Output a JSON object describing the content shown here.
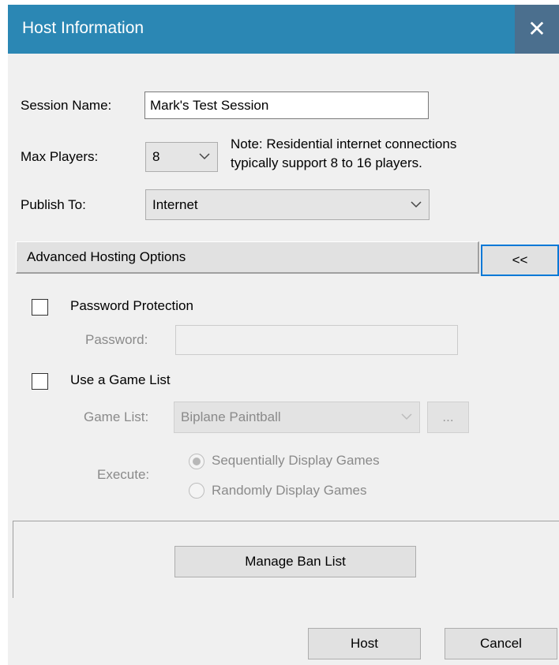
{
  "window": {
    "title": "Host Information",
    "close_symbol": "✕"
  },
  "session": {
    "label": "Session Name:",
    "value": "Mark's Test Session"
  },
  "max_players": {
    "label": "Max Players:",
    "value": "8",
    "note_line1": "Note: Residential internet connections",
    "note_line2": "typically support 8 to 16 players."
  },
  "publish": {
    "label": "Publish To:",
    "value": "Internet"
  },
  "advanced": {
    "label": "Advanced Hosting Options",
    "toggle_label": "<<"
  },
  "password": {
    "checkbox_label": "Password Protection",
    "field_label": "Password:",
    "value": "",
    "checked": false
  },
  "game_list": {
    "checkbox_label": "Use a Game List",
    "checked": false,
    "field_label": "Game List:",
    "value": "Biplane Paintball",
    "browse_label": "..."
  },
  "execute": {
    "label": "Execute:",
    "options": [
      {
        "label": "Sequentially Display Games",
        "selected": true
      },
      {
        "label": "Randomly Display Games",
        "selected": false
      }
    ]
  },
  "ban": {
    "button_label": "Manage Ban List"
  },
  "footer": {
    "host_label": "Host",
    "cancel_label": "Cancel"
  },
  "colors": {
    "title_bar": "#2b87b4",
    "close_button": "#4b6f8e",
    "focus_border": "#0078d7",
    "dialog_bg": "#f0f0f0"
  }
}
